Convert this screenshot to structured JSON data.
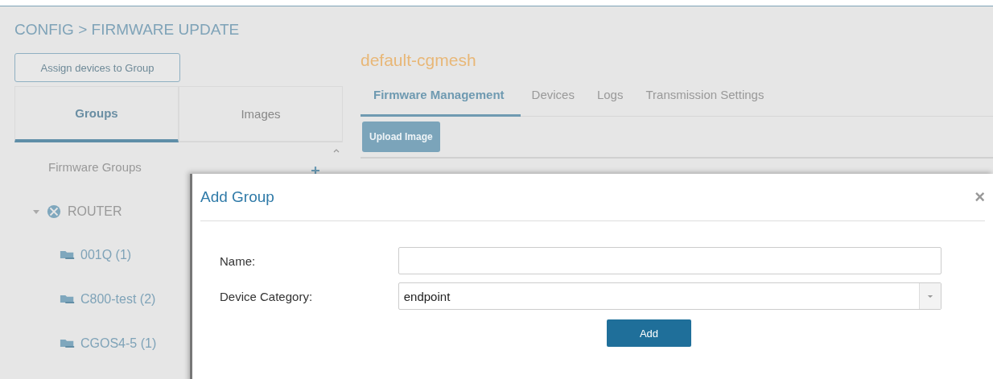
{
  "breadcrumb": "CONFIG > FIRMWARE UPDATE",
  "assign_button": "Assign devices to Group",
  "side_tabs": [
    {
      "label": "Groups",
      "selected": true
    },
    {
      "label": "Images",
      "selected": false
    }
  ],
  "groups_header": "Firmware Groups",
  "tree": [
    {
      "label": "ROUTER",
      "expanded": true,
      "children": [
        {
          "label": "001Q (1)"
        },
        {
          "label": "C800-test (2)"
        },
        {
          "label": "CGOS4-5 (1)"
        }
      ]
    }
  ],
  "project_title": "default-cgmesh",
  "tabs": [
    {
      "label": "Firmware Management",
      "selected": true
    },
    {
      "label": "Devices",
      "selected": false
    },
    {
      "label": "Logs",
      "selected": false
    },
    {
      "label": "Transmission Settings",
      "selected": false
    }
  ],
  "upload_button": "Upload Image",
  "dialog": {
    "title": "Add Group",
    "close": "×",
    "fields": [
      {
        "kind": "text",
        "label": "Name:"
      },
      {
        "kind": "select",
        "label": "Device Category:",
        "value": "endpoint"
      }
    ],
    "button": "Add"
  }
}
